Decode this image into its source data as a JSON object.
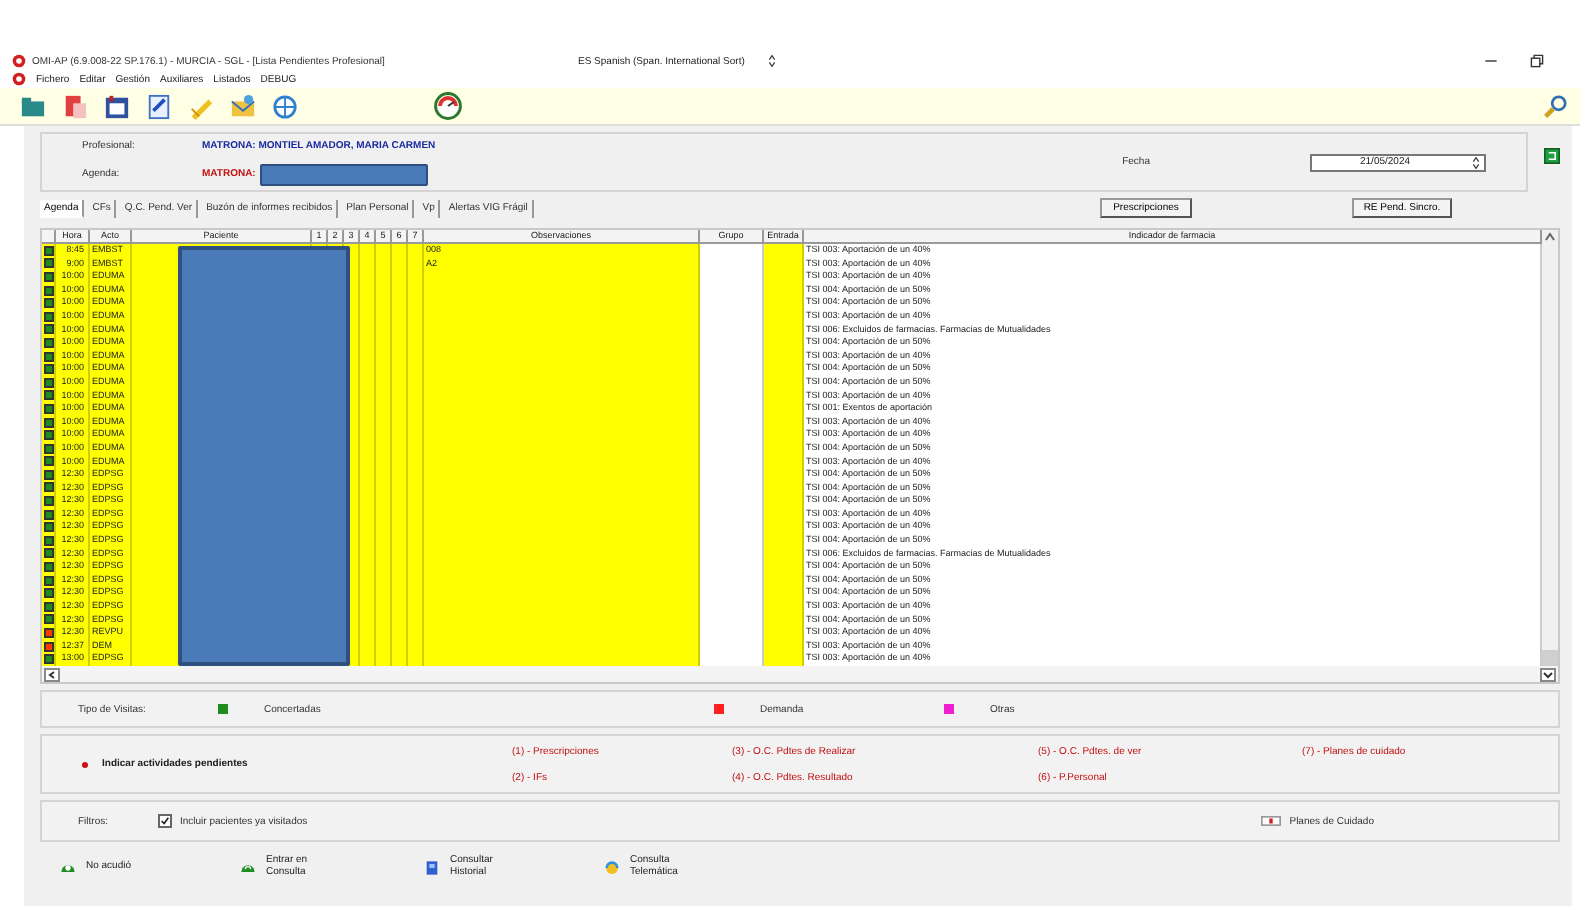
{
  "window": {
    "title": "OMI-AP (6.9.008-22 SP.176.1) - MURCIA - SGL - [Lista Pendientes Profesional]",
    "language": "ES Spanish (Span. International Sort)"
  },
  "menu": [
    "Fichero",
    "Editar",
    "Gestión",
    "Auxiliares",
    "Listados",
    "DEBUG"
  ],
  "header": {
    "profesional_label": "Profesional:",
    "profesional": "MATRONA: MONTIEL AMADOR, MARIA CARMEN",
    "agenda_label": "Agenda:",
    "agenda": "MATRONA:",
    "fecha_label": "Fecha",
    "fecha": "21/05/2024"
  },
  "tabs": [
    {
      "label": "Agenda",
      "selected": true
    },
    {
      "label": "CFs",
      "selected": false
    },
    {
      "label": "Q.C. Pend. Ver",
      "selected": false
    },
    {
      "label": "Buzón de informes recibidos",
      "selected": false
    },
    {
      "label": "Plan Personal",
      "selected": false
    },
    {
      "label": "Vp",
      "selected": false
    },
    {
      "label": "Alertas VIG Frágil",
      "selected": false
    }
  ],
  "buttons": [
    "Prescripciones",
    "RE Pend. Sincro."
  ],
  "table": {
    "columns": [
      "Hora",
      "Acto",
      "Paciente",
      "1",
      "2",
      "3",
      "4",
      "5",
      "6",
      "7",
      "Observaciones",
      "Grupo",
      "Entrada",
      "Indicador de farmacia"
    ],
    "rows": [
      {
        "color": "#1e8c1e",
        "hora": "8:45",
        "acto": "EMBST",
        "observaciones": "008",
        "indicador": "TSI 003: Aportación de un 40%"
      },
      {
        "color": "#1e8c1e",
        "hora": "9:00",
        "acto": "EMBST",
        "observaciones": "A2",
        "indicador": "TSI 003: Aportación de un 40%"
      },
      {
        "color": "#1e8c1e",
        "hora": "10:00",
        "acto": "EDUMA",
        "indicador": "TSI 003: Aportación de un 40%"
      },
      {
        "color": "#1e8c1e",
        "hora": "10:00",
        "acto": "EDUMA",
        "indicador": "TSI 004: Aportación de un 50%"
      },
      {
        "color": "#1e8c1e",
        "hora": "10:00",
        "acto": "EDUMA",
        "indicador": "TSI 004: Aportación de un 50%"
      },
      {
        "color": "#1e8c1e",
        "hora": "10:00",
        "acto": "EDUMA",
        "indicador": "TSI 003: Aportación de un 40%"
      },
      {
        "color": "#1e8c1e",
        "hora": "10:00",
        "acto": "EDUMA",
        "indicador": "TSI 006: Excluidos de farmacias. Farmacias de Mutualidades"
      },
      {
        "color": "#1e8c1e",
        "hora": "10:00",
        "acto": "EDUMA",
        "indicador": "TSI 004: Aportación de un 50%"
      },
      {
        "color": "#1e8c1e",
        "hora": "10:00",
        "acto": "EDUMA",
        "indicador": "TSI 003: Aportación de un 40%"
      },
      {
        "color": "#1e8c1e",
        "hora": "10:00",
        "acto": "EDUMA",
        "indicador": "TSI 004: Aportación de un 50%"
      },
      {
        "color": "#1e8c1e",
        "hora": "10:00",
        "acto": "EDUMA",
        "indicador": "TSI 004: Aportación de un 50%"
      },
      {
        "color": "#1e8c1e",
        "hora": "10:00",
        "acto": "EDUMA",
        "indicador": "TSI 003: Aportación de un 40%"
      },
      {
        "color": "#1e8c1e",
        "hora": "10:00",
        "acto": "EDUMA",
        "indicador": "TSI 001: Exentos de aportación"
      },
      {
        "color": "#1e8c1e",
        "hora": "10:00",
        "acto": "EDUMA",
        "indicador": "TSI 003: Aportación de un 40%"
      },
      {
        "color": "#1e8c1e",
        "hora": "10:00",
        "acto": "EDUMA",
        "indicador": "TSI 003: Aportación de un 40%"
      },
      {
        "color": "#1e8c1e",
        "hora": "10:00",
        "acto": "EDUMA",
        "indicador": "TSI 004: Aportación de un 50%"
      },
      {
        "color": "#1e8c1e",
        "hora": "10:00",
        "acto": "EDUMA",
        "indicador": "TSI 003: Aportación de un 40%"
      },
      {
        "color": "#1e8c1e",
        "hora": "12:30",
        "acto": "EDPSG",
        "indicador": "TSI 004: Aportación de un 50%"
      },
      {
        "color": "#1e8c1e",
        "hora": "12:30",
        "acto": "EDPSG",
        "indicador": "TSI 004: Aportación de un 50%"
      },
      {
        "color": "#1e8c1e",
        "hora": "12:30",
        "acto": "EDPSG",
        "indicador": "TSI 004: Aportación de un 50%"
      },
      {
        "color": "#1e8c1e",
        "hora": "12:30",
        "acto": "EDPSG",
        "indicador": "TSI 003: Aportación de un 40%"
      },
      {
        "color": "#1e8c1e",
        "hora": "12:30",
        "acto": "EDPSG",
        "indicador": "TSI 003: Aportación de un 40%"
      },
      {
        "color": "#1e8c1e",
        "hora": "12:30",
        "acto": "EDPSG",
        "indicador": "TSI 004: Aportación de un 50%"
      },
      {
        "color": "#1e8c1e",
        "hora": "12:30",
        "acto": "EDPSG",
        "indicador": "TSI 006: Excluidos de farmacias. Farmacias de Mutualidades"
      },
      {
        "color": "#1e8c1e",
        "hora": "12:30",
        "acto": "EDPSG",
        "indicador": "TSI 004: Aportación de un 50%"
      },
      {
        "color": "#1e8c1e",
        "hora": "12:30",
        "acto": "EDPSG",
        "indicador": "TSI 004: Aportación de un 50%"
      },
      {
        "color": "#1e8c1e",
        "hora": "12:30",
        "acto": "EDPSG",
        "indicador": "TSI 004: Aportación de un 50%"
      },
      {
        "color": "#1e8c1e",
        "hora": "12:30",
        "acto": "EDPSG",
        "indicador": "TSI 003: Aportación de un 40%"
      },
      {
        "color": "#1e8c1e",
        "hora": "12:30",
        "acto": "EDPSG",
        "indicador": "TSI 004: Aportación de un 50%"
      },
      {
        "color": "#ff3c00",
        "hora": "12:30",
        "acto": "REVPU",
        "indicador": "TSI 003: Aportación de un 40%"
      },
      {
        "color": "#ff3c00",
        "hora": "12:37",
        "acto": "DEM",
        "indicador": "TSI 003: Aportación de un 40%"
      },
      {
        "color": "#1e8c1e",
        "hora": "13:00",
        "acto": "EDPSG",
        "indicador": "TSI 003: Aportación de un 40%"
      }
    ]
  },
  "legend": {
    "label": "Tipo de Visitas:",
    "items": [
      {
        "label": "Concertadas",
        "color": "#1e8c1e"
      },
      {
        "label": "Demanda",
        "color": "#ff2020"
      },
      {
        "label": "Otras",
        "color": "#f020d0"
      }
    ]
  },
  "pendientes": {
    "label": "Indicar actividades pendientes",
    "links": [
      "(1) - Prescripciones",
      "(2) - IFs",
      "(3) - O.C. Pdtes de Realizar",
      "(4) - O.C. Pdtes. Resultado",
      "(5) - O.C. Pdtes. de ver",
      "(6) - P.Personal",
      "(7) - Planes de cuidado"
    ]
  },
  "filtros": {
    "label": "Filtros:",
    "checkbox": {
      "label": "Incluir pacientes ya visitados",
      "checked": true
    },
    "planes": "Planes de Cuidado"
  },
  "actions": [
    {
      "kind": "absent",
      "label": "No acudió"
    },
    {
      "kind": "enter",
      "label": "Entrar en Consulta"
    },
    {
      "kind": "history",
      "label": "Consultar Historial"
    },
    {
      "kind": "remote",
      "label": "Consulta Telemática"
    }
  ]
}
